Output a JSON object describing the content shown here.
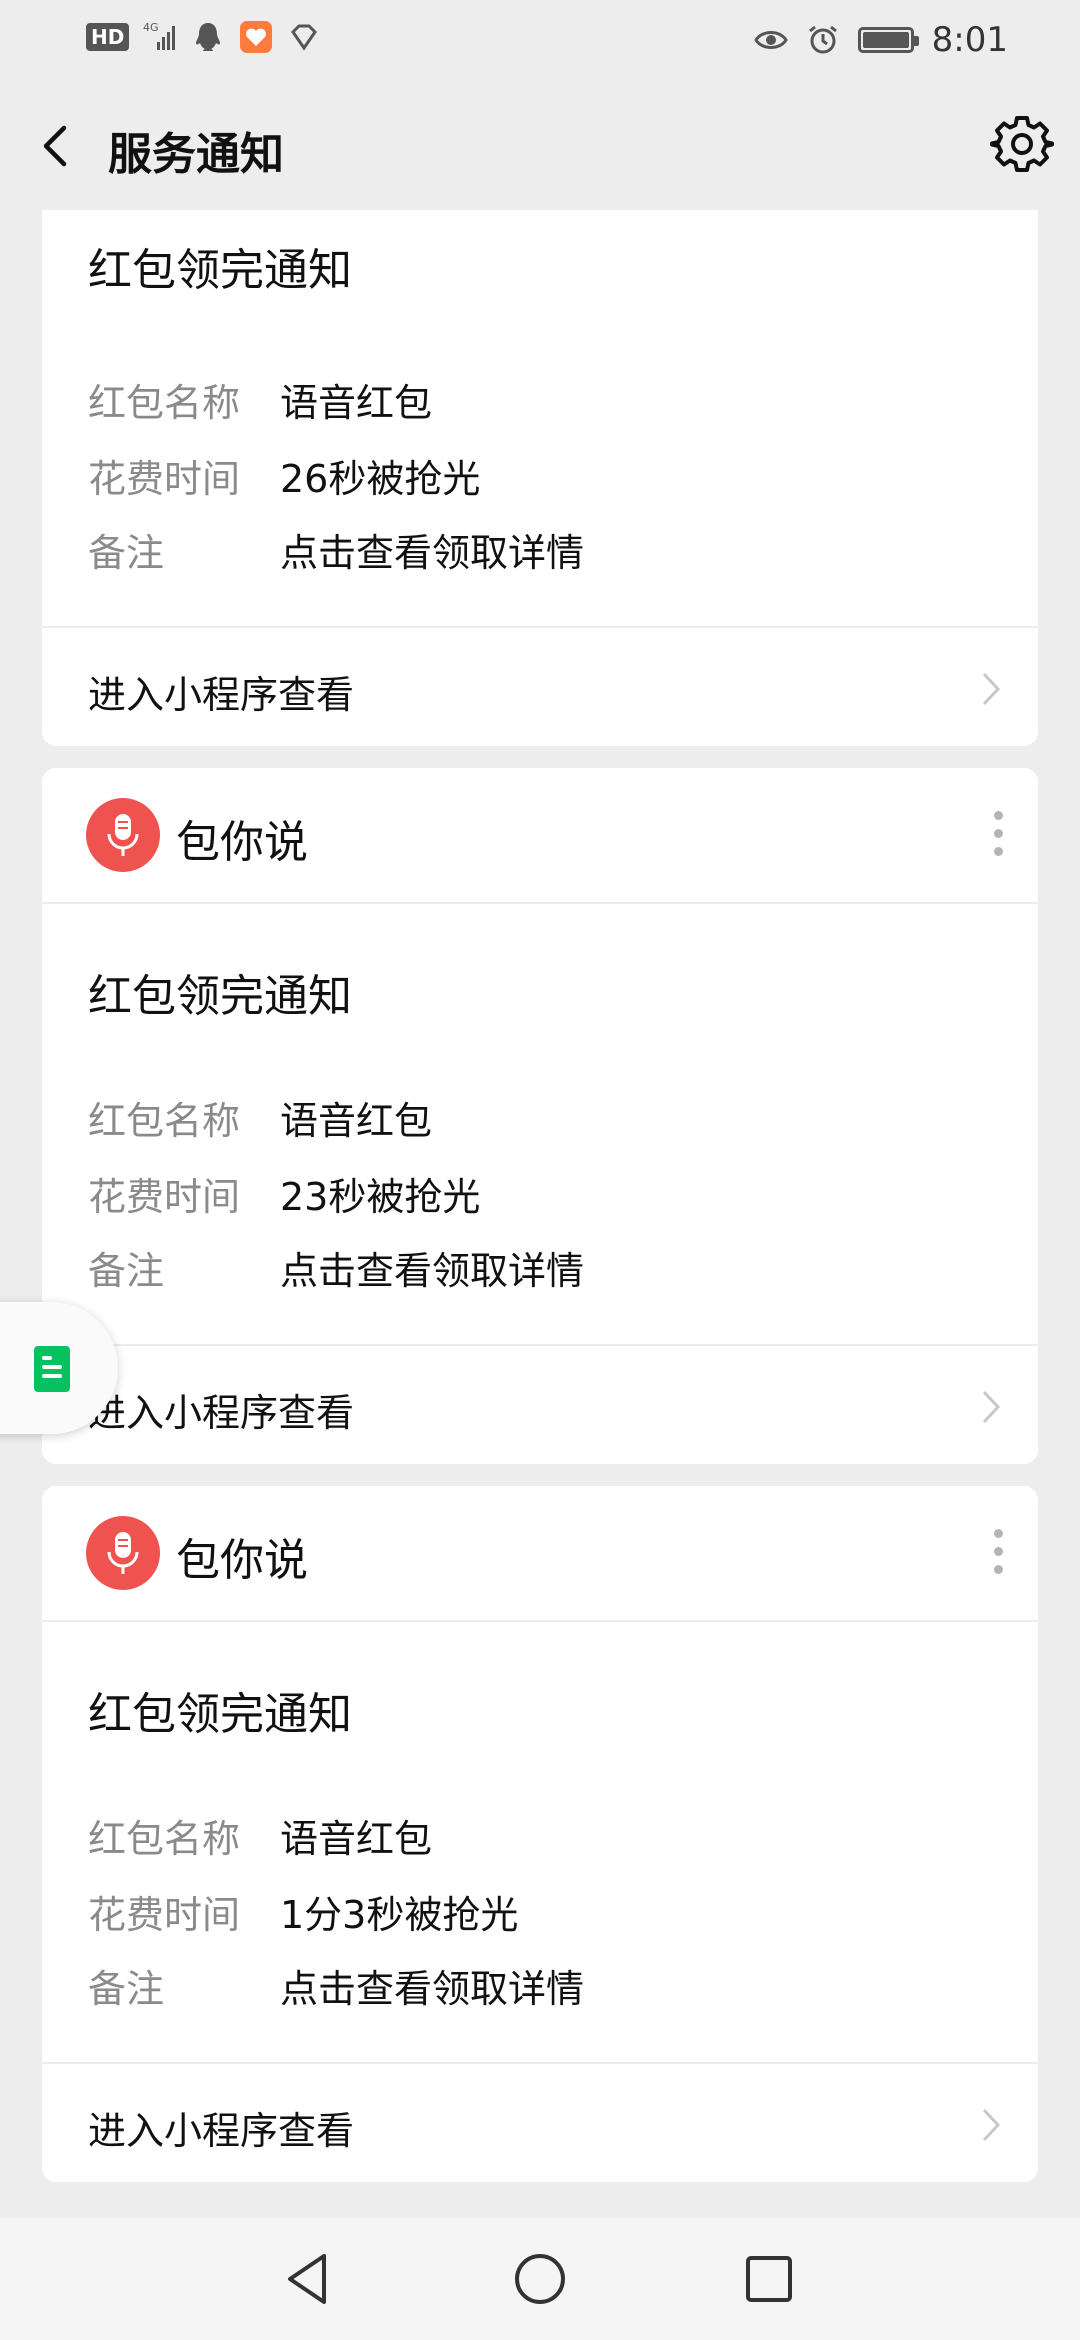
{
  "status_bar": {
    "network": "HD",
    "signal_label": "4G",
    "time": "8:01",
    "icons": [
      "hd-icon",
      "signal-icon",
      "qq-icon",
      "health-app-icon",
      "vpn-icon",
      "eye-icon",
      "alarm-icon",
      "battery-icon"
    ]
  },
  "header": {
    "title": "服务通知",
    "back_icon": "back-arrow-icon",
    "settings_icon": "gear-icon"
  },
  "cards": [
    {
      "app_name": "",
      "notice_title": "红包领完通知",
      "fields": [
        {
          "key": "红包名称",
          "value": "语音红包"
        },
        {
          "key": "花费时间",
          "value": "26秒被抢光"
        },
        {
          "key": "备注",
          "value": "点击查看领取详情"
        }
      ],
      "footer_label": "进入小程序查看"
    },
    {
      "app_name": "包你说",
      "notice_title": "红包领完通知",
      "fields": [
        {
          "key": "红包名称",
          "value": "语音红包"
        },
        {
          "key": "花费时间",
          "value": "23秒被抢光"
        },
        {
          "key": "备注",
          "value": "点击查看领取详情"
        }
      ],
      "footer_label": "进入小程序查看"
    },
    {
      "app_name": "包你说",
      "notice_title": "红包领完通知",
      "fields": [
        {
          "key": "红包名称",
          "value": "语音红包"
        },
        {
          "key": "花费时间",
          "value": "1分3秒被抢光"
        },
        {
          "key": "备注",
          "value": "点击查看领取详情"
        }
      ],
      "footer_label": "进入小程序查看"
    }
  ],
  "colors": {
    "background": "#ededed",
    "card": "#ffffff",
    "app_icon": "#ef5350",
    "float_doc": "#07c160",
    "muted_text": "#8a8a8a"
  }
}
